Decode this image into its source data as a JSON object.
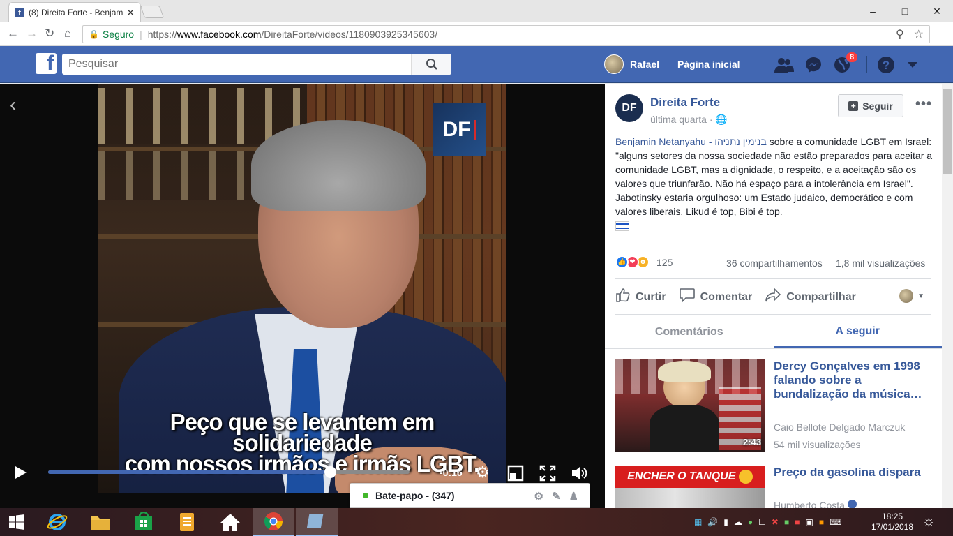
{
  "browser": {
    "tab_title": "(8) Direita Forte - Benjam",
    "tab_close": "✕",
    "secure_label": "Seguro",
    "url_prefix": "https://",
    "url_host": "www.facebook.com",
    "url_path": "/DireitaForte/videos/1180903925345603/"
  },
  "fb": {
    "search_placeholder": "Pesquisar",
    "user_name": "Rafael",
    "home_label": "Página inicial",
    "notifications_count": "8",
    "brand_color": "#4267b2"
  },
  "video": {
    "subtitle_line1": "Peço que se levantem em solidariedade",
    "subtitle_line2": "com nossos irmãos e irmãs LGBT.",
    "logo_text": "DF",
    "time_remaining": "-0:16",
    "progress": 0.78
  },
  "chat": {
    "label": "Bate-papo - (347)"
  },
  "post": {
    "page_avatar_text": "DF",
    "page_name": "Direita Forte",
    "time": "última quarta",
    "time_sep": "·",
    "follow_label": "Seguir",
    "more": "•••",
    "text_link": "Benjamin Netanyahu - בנימין נתניהו",
    "text_body": " sobre a comunidade LGBT em Israel: \"alguns setores da nossa sociedade não estão preparados para aceitar a comunidade LGBT, mas a dignidade, o respeito, e a aceitação são os valores que triunfarão. Não há espaço para a intolerância em Israel\". Jabotinsky estaria orgulhoso: um Estado judaico, democrático e com valores liberais. Likud é top, Bibi é top.",
    "reactions_count": "125",
    "shares": "36 compartilhamentos",
    "views": "1,8 mil visualizações",
    "action_like": "Curtir",
    "action_comment": "Comentar",
    "action_share": "Compartilhar"
  },
  "tabs": [
    {
      "label": "Comentários",
      "active": false
    },
    {
      "label": "A seguir",
      "active": true
    }
  ],
  "up_next": [
    {
      "title": "Dercy Gonçalves em 1998 falando sobre a bundalização da música…",
      "author": "Caio Bellote Delgado Marczuk",
      "views": "54 mil visualizações",
      "duration": "2:43"
    },
    {
      "title": "Preço da gasolina dispara",
      "thumb_text": "ENCHER O TANQUE",
      "author": "Humberto Costa"
    }
  ],
  "taskbar": {
    "time": "18:25",
    "date": "17/01/2018"
  }
}
